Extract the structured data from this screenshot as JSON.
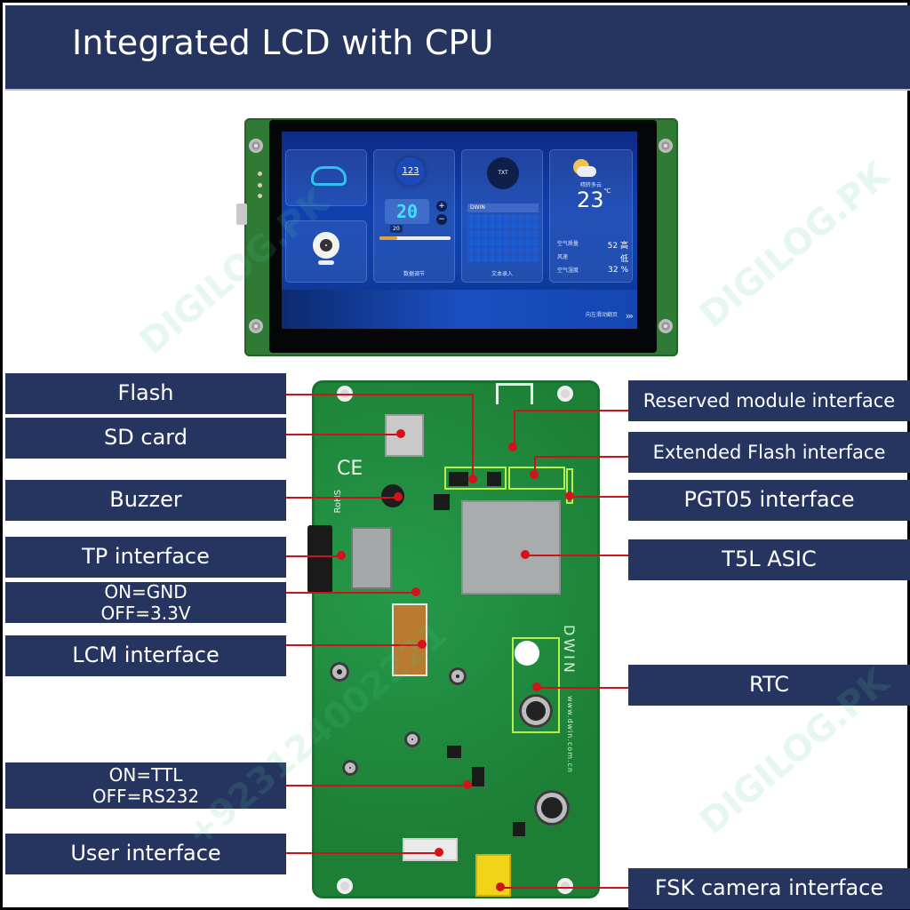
{
  "header": {
    "title": "Integrated LCD with CPU"
  },
  "colors": {
    "label_bg": "#263560",
    "leader_line": "#c9141b",
    "pcb_green": "#1f8a3a",
    "highlight_box": "#b6f04a"
  },
  "lcd_screen": {
    "cards": {
      "data_adjust": {
        "badge": "123",
        "value": "20",
        "plus": "+",
        "minus": "−",
        "slider_value": "20",
        "slider_fraction": 0.25,
        "label": "数据调节"
      },
      "text_input": {
        "file_badge": "TXT",
        "input_value": "DWIN",
        "label": "文本录入"
      },
      "weather": {
        "description": "晴转多云",
        "temperature": "23",
        "unit": "℃",
        "rows": [
          {
            "label": "空气质量",
            "value": "52 高"
          },
          {
            "label": "风速",
            "value": "低"
          },
          {
            "label": "空气湿度",
            "value": "32 %"
          }
        ]
      }
    },
    "swipe_hint": "向左滑动翻页",
    "swipe_icon": "chevrons-right-icon"
  },
  "pcb": {
    "silkscreen": {
      "ce": "CE",
      "rohs": "RoHS",
      "brand": "DWIN",
      "url": "www.dwin.com.cn"
    }
  },
  "callouts": {
    "left": [
      {
        "text": "Flash"
      },
      {
        "text": "SD card"
      },
      {
        "text": "Buzzer"
      },
      {
        "text": "TP interface"
      },
      {
        "line1": "ON=GND",
        "line2": "OFF=3.3V"
      },
      {
        "text": "LCM interface"
      },
      {
        "line1": "ON=TTL",
        "line2": "OFF=RS232"
      },
      {
        "text": "User interface"
      }
    ],
    "right": [
      {
        "text": "Reserved module interface"
      },
      {
        "text": "Extended Flash interface"
      },
      {
        "text": "PGT05 interface"
      },
      {
        "text": "T5L ASIC"
      },
      {
        "text": "RTC"
      },
      {
        "text": "FSK camera interface"
      }
    ]
  },
  "watermark": {
    "brand": "DIGILOG.PK",
    "phone": "+923124002221"
  }
}
